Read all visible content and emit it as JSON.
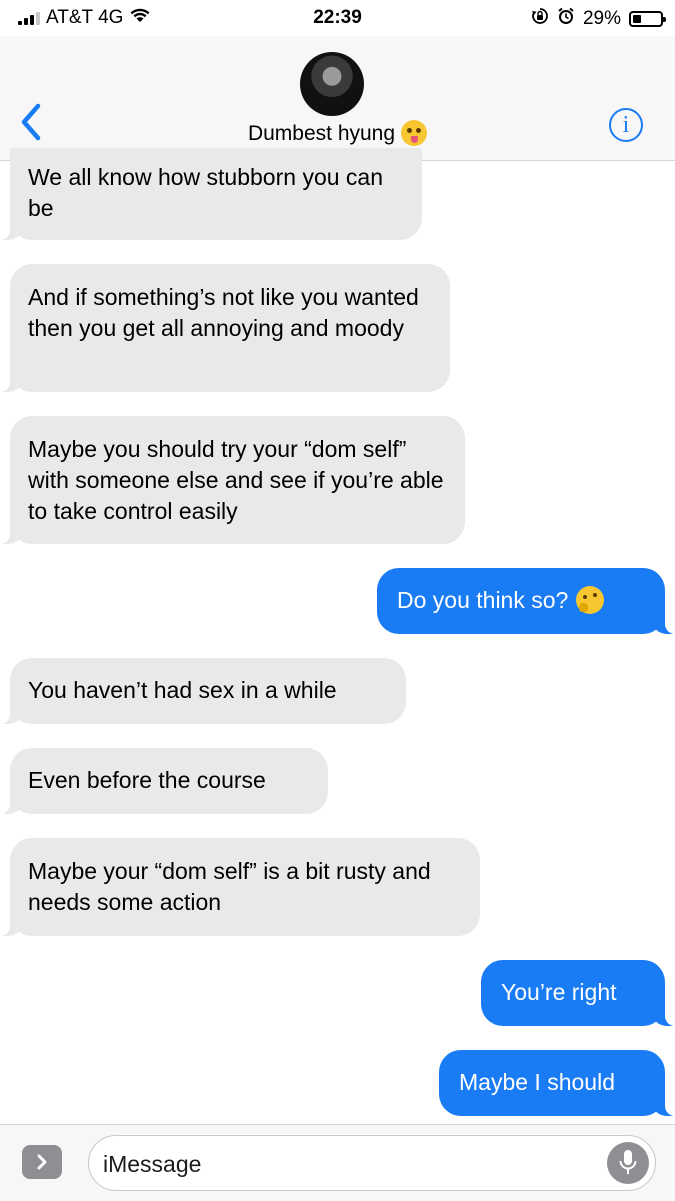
{
  "status_bar": {
    "carrier": "AT&T 4G",
    "time": "22:39",
    "battery_percent": "29%",
    "battery_level": 0.29,
    "icons": [
      "signal-icon",
      "wifi-icon",
      "orientation-lock-icon",
      "alarm-icon",
      "battery-icon"
    ]
  },
  "header": {
    "contact_name": "Dumbest hyung",
    "contact_emoji": "zany-face-emoji",
    "info_glyph": "i"
  },
  "messages": [
    {
      "from": "contact",
      "text": "We all know how stubborn you can be"
    },
    {
      "from": "contact",
      "text": "And if something’s not like you wanted then you get all annoying and moody"
    },
    {
      "from": "contact",
      "text": "Maybe you should try your “dom self” with someone else and see if you’re able to take control easily"
    },
    {
      "from": "me",
      "text": "Do you think so?",
      "emoji": "thinking-face-emoji"
    },
    {
      "from": "contact",
      "text": "You haven’t had sex in a while"
    },
    {
      "from": "contact",
      "text": "Even before the course"
    },
    {
      "from": "contact",
      "text": "Maybe your “dom self” is a bit rusty and needs some action"
    },
    {
      "from": "me",
      "text": "You’re right"
    },
    {
      "from": "me",
      "text": "Maybe I should"
    }
  ],
  "input_bar": {
    "placeholder": "iMessage"
  },
  "colors": {
    "sent_bubble": "#1a7cf5",
    "received_bubble": "#e9e9eb",
    "accent": "#1a7cf5"
  }
}
